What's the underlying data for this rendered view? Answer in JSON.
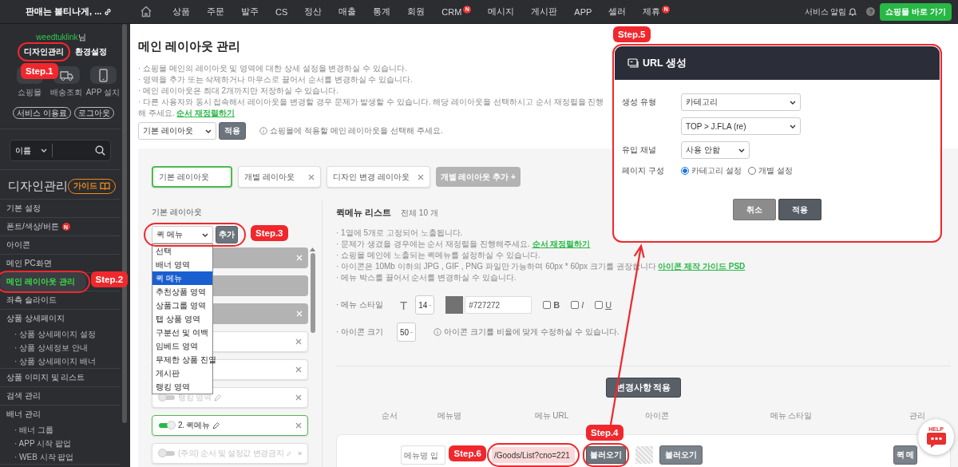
{
  "topbar": {
    "brand": "판매는 볼티나게, ...",
    "menu": [
      {
        "label": "상품"
      },
      {
        "label": "주문"
      },
      {
        "label": "발주"
      },
      {
        "label": "CS"
      },
      {
        "label": "정산"
      },
      {
        "label": "매출"
      },
      {
        "label": "통계"
      },
      {
        "label": "회원"
      },
      {
        "label": "CRM",
        "badge": "N"
      },
      {
        "label": "메시지"
      },
      {
        "label": "게시판"
      },
      {
        "label": "APP"
      },
      {
        "label": "셀러"
      },
      {
        "label": "제휴",
        "badge": "N"
      }
    ],
    "notify": "서비스 알림",
    "help": "?",
    "shop_button": "쇼핑몰 바로 가기"
  },
  "sidebar": {
    "user": "weedtuklink",
    "user_suffix": "님",
    "tabs": [
      "디자인관리",
      "환경설정"
    ],
    "shortcuts": [
      {
        "kind": "shop",
        "label": "쇼핑몰"
      },
      {
        "kind": "delivery",
        "label": "배송조회"
      },
      {
        "kind": "app",
        "label": "APP 설치"
      }
    ],
    "pills": [
      "서비스 이용료",
      "로그아웃"
    ],
    "search": {
      "option": "이름"
    },
    "section": "디자인관리",
    "guide": "가이드",
    "menu": [
      {
        "label": "기본 설정",
        "selected": false
      },
      {
        "label": "폰트/색상/버튼",
        "selected": false,
        "badge": "N"
      },
      {
        "label": "아이콘",
        "selected": false
      },
      {
        "label": "메인 PC화면",
        "selected": false
      },
      {
        "label": "메인 레이아웃 관리",
        "selected": true
      },
      {
        "label": "좌측 슬라이드",
        "selected": false
      },
      {
        "label": "상품 상세페이지",
        "selected": false,
        "children": [
          {
            "label": "· 상품 상세페이지 설정",
            "selected": false
          },
          {
            "label": "· 상품 상세정보 안내",
            "selected": false
          },
          {
            "label": "· 상품 상세페이지 배너",
            "selected": false
          }
        ]
      },
      {
        "label": "상품 이미지 및 리스트",
        "selected": false
      },
      {
        "label": "검색 관리",
        "selected": false
      },
      {
        "label": "배너 관리",
        "selected": false,
        "children": [
          {
            "label": "· 배너 그룹",
            "selected": false
          },
          {
            "label": "· APP 시작 팝업",
            "selected": false
          },
          {
            "label": "· WEB 시작 팝업",
            "selected": false
          }
        ]
      }
    ]
  },
  "page": {
    "title": "메인 레이아웃 관리",
    "notes": [
      {
        "text": "· 쇼핑몰 메인의 레이아웃 및 영역에 대한 상세 설정을 변경하실 수 있습니다."
      },
      {
        "text": "· 영역을 추가 또는 삭제하거나 마우스로 끌어서 순서를 변경하실 수 있습니다."
      },
      {
        "text": "· 메인 레이아웃은 최대 2개까지만 저장하실 수 있습니다."
      },
      {
        "text": "· 다른 사용자와 동시 접속해서 레이아웃을 변경할 경우 문제가 발생할 수 있습니다. 해당 레이아웃을 선택하시고 순서 재정렬을 진행해 주세요.",
        "link": "순서 재정렬하기"
      }
    ],
    "layout_select": "기본 레이아웃",
    "apply": "적용",
    "hint": "쇼핑몰에 적용할 메인 레이아웃을 선택해 주세요."
  },
  "layout_tabs": [
    {
      "label": "기본 레이아웃",
      "selected": true,
      "closable": false
    },
    {
      "label": "개별 레이아웃",
      "selected": false,
      "closable": true
    },
    {
      "label": "디자인 변경 레이아웃",
      "selected": false,
      "closable": true
    }
  ],
  "add_layout": "개별 레이아웃 추가 +",
  "blocks_panel": {
    "title": "기본 레이아웃",
    "type_select": "퀵 메뉴",
    "add": "추가",
    "dropdown": [
      {
        "label": "선택",
        "selected": false
      },
      {
        "label": "배너 영역",
        "selected": false
      },
      {
        "label": "퀵 메뉴",
        "selected": true
      },
      {
        "label": "추천상품 영역",
        "selected": false
      },
      {
        "label": "상품그룹 영역",
        "selected": false
      },
      {
        "label": "탭 상품 영역",
        "selected": false
      },
      {
        "label": "구분선 및 여백",
        "selected": false
      },
      {
        "label": "임베드 영역",
        "selected": false
      },
      {
        "label": "무제한 상품 진열",
        "selected": false
      },
      {
        "label": "게시판",
        "selected": false
      },
      {
        "label": "랭킹 영역",
        "selected": false
      }
    ],
    "blocks": [
      {
        "kind": "bar",
        "closable": true,
        "selected": false
      },
      {
        "kind": "bar",
        "closable": false,
        "selected": false
      },
      {
        "kind": "bar",
        "closable": true,
        "selected": false
      },
      {
        "kind": "row",
        "closable": true,
        "selected": false
      },
      {
        "kind": "row",
        "closable": true,
        "selected": false
      },
      {
        "kind": "row",
        "closable": true,
        "selected": false,
        "label": "랭킹 영역",
        "on": false
      },
      {
        "kind": "row",
        "closable": true,
        "selected": true,
        "label": "2. 퀵메뉴",
        "on": true
      },
      {
        "kind": "row",
        "closable": true,
        "selected": false,
        "label": "(주의) 순서 및 설정값 변경금지",
        "on": false
      }
    ]
  },
  "quick": {
    "title": "퀵메뉴 리스트",
    "count": "전체 10 개",
    "notes": [
      {
        "text": "· 1열에 5개로 고정되어 노출됩니다."
      },
      {
        "text": "· 문제가 생겼을 경우에는 순서 재정렬을 진행해주세요.",
        "link": "순서 재정렬하기"
      },
      {
        "text": "· 쇼핑몰 메인에 노출되는 퀵메뉴를 설정하실 수 있습니다."
      },
      {
        "text": "· 아이콘은 10Mb 이하의 JPG , GIF , PNG 파일만 가능하며 60px * 60px 크기를 권장합니다",
        "link": "아이콘 제작 가이드 PSD"
      },
      {
        "text": "· 메뉴 박스를 끌어서 순서를 변경하실 수 있습니다."
      }
    ],
    "style_label": "· 메뉴 스타일",
    "t_glyph": "T",
    "font_size": "14",
    "color": "#727272",
    "checks": [
      {
        "label": "B",
        "kind": "bold",
        "checked": false
      },
      {
        "label": "I",
        "kind": "italic",
        "checked": false
      },
      {
        "label": "U",
        "kind": "underline",
        "checked": false
      }
    ],
    "icon_size_label": "· 아이콘 크기",
    "icon_size": "50",
    "icon_hint": "아이콘 크기를 비율에 맞게 수정하실 수 있습니다.",
    "apply_changes": "변경사항 적용",
    "columns": [
      "순서",
      "메뉴명",
      "메뉴 URL",
      "아이콘",
      "메뉴 스타일",
      "관리"
    ],
    "row": {
      "name_placeholder": "메뉴명 입",
      "url": "/Goods/List?cno=221",
      "load": "불러오기",
      "icon_load": "불러오기",
      "style_button": "퀵 메"
    }
  },
  "dialog": {
    "title": "URL 생성",
    "fields": [
      {
        "kind": "select",
        "label": "생성 유형",
        "value": "카테고리"
      },
      {
        "kind": "select",
        "value": "TOP > J.FLA (re)"
      },
      {
        "kind": "short-select",
        "label": "유입 채널",
        "value": "사용 안함"
      },
      {
        "kind": "radio",
        "label": "페이지 구성",
        "options": [
          {
            "label": "카테고리 설정",
            "selected": true
          },
          {
            "label": "개별 설정",
            "selected": false
          }
        ]
      }
    ],
    "buttons": [
      {
        "kind": "cancel",
        "label": "취소"
      },
      {
        "kind": "primary",
        "label": "적용"
      }
    ]
  },
  "annotations": [
    {
      "label": "Step.1"
    },
    {
      "label": "Step.2"
    },
    {
      "label": "Step.3"
    },
    {
      "label": "Step.4"
    },
    {
      "label": "Step.5"
    },
    {
      "label": "Step.6"
    }
  ],
  "help": {
    "label": "HELP"
  }
}
